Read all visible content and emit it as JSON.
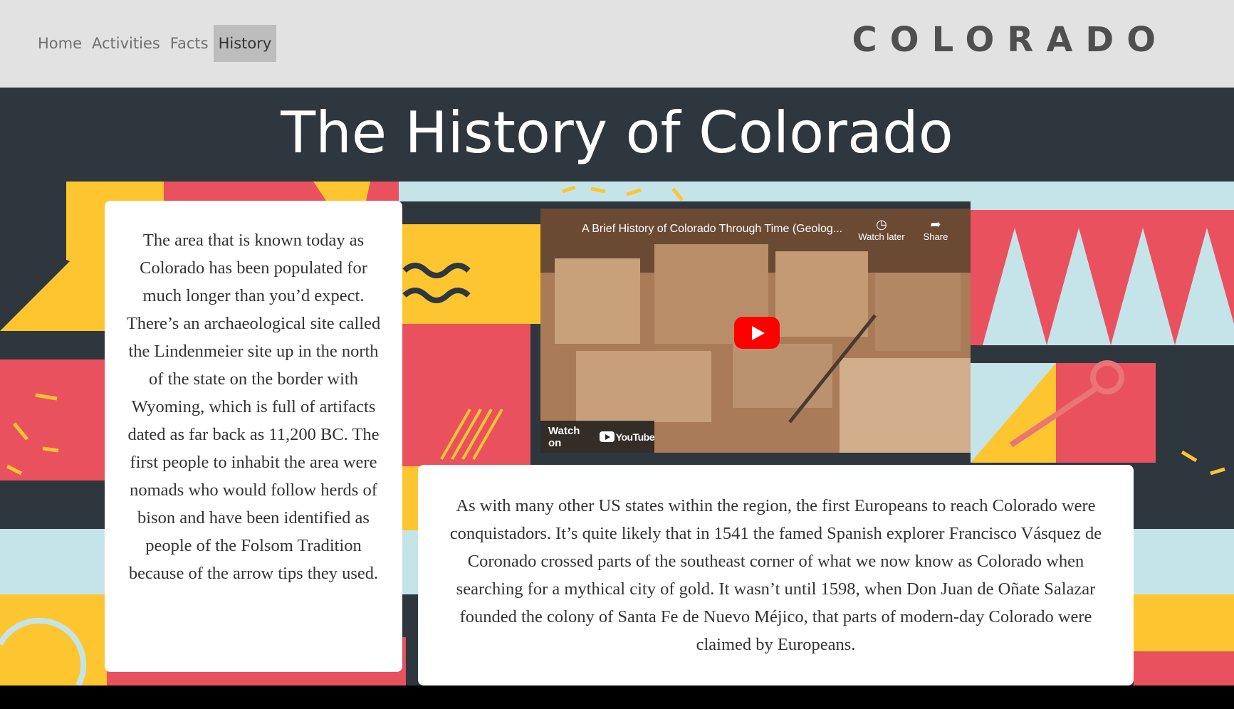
{
  "nav": {
    "links": [
      "Home",
      "Activities",
      "Facts",
      "History"
    ],
    "active": "History",
    "brand": "COLORADO"
  },
  "hero": {
    "title": "The History of Colorado"
  },
  "left_card": {
    "text": "The area that is known today as Colorado has been populated for much longer than you’d expect. There’s an archaeological site called the Lindenmeier site up in the north of the state on the border with Wyoming, which is full of artifacts dated as far back as 11,200 BC. The first people to inhabit the area were nomads who would follow herds of bison and have been identified as people of the Folsom Tradition because of the arrow tips they used."
  },
  "bottom_card": {
    "text": "As with many other US states within the region, the first Europeans to reach Colorado were conquistadors. It’s quite likely that in 1541 the famed Spanish explorer Francisco Vásquez de Coronado crossed parts of the southeast corner of what we now know as Colorado when searching for a mythical city of gold. It wasn’t until 1598, when Don Juan de Oñate Salazar founded the colony of Santa Fe de Nuevo Méjico, that parts of modern-day Colorado were claimed by Europeans."
  },
  "video": {
    "title": "A Brief History of Colorado Through Time (Geolog...",
    "watch_later": "Watch later",
    "share": "Share",
    "watch_on": "Watch on",
    "youtube": "YouTube"
  },
  "colors": {
    "nav_bg": "#e2e2e2",
    "hero_bg": "#2e363e",
    "pattern_red": "#e9515f",
    "pattern_yellow": "#fdc630",
    "pattern_blue": "#c5e4ea"
  }
}
